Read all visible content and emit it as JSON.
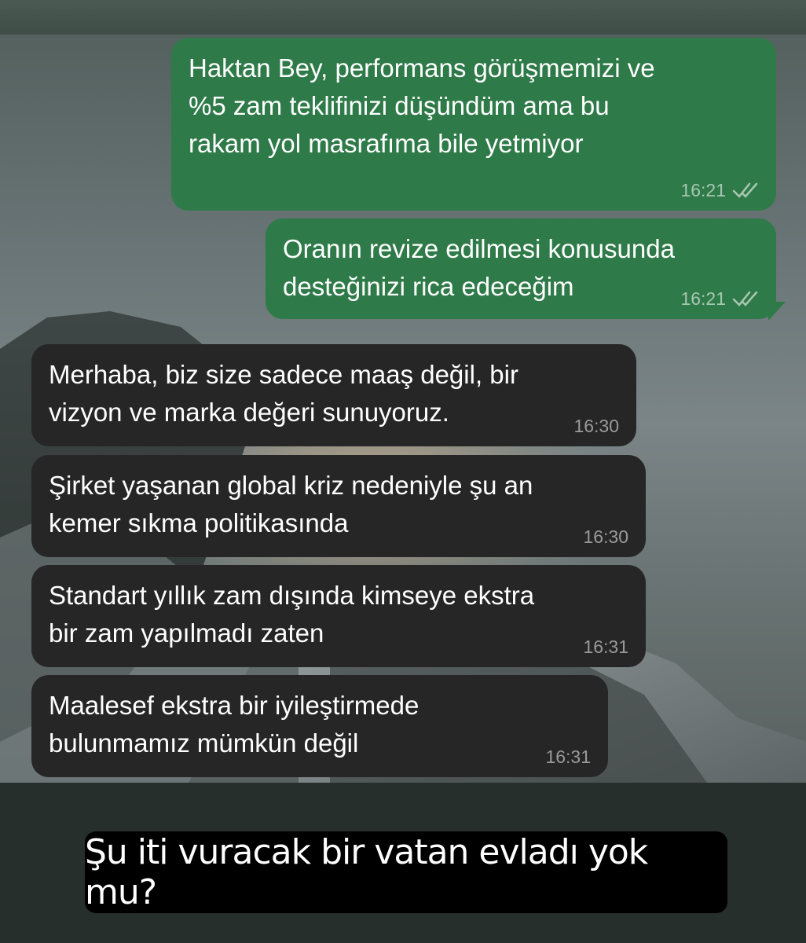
{
  "colors": {
    "outgoing_bubble": "#2e7a48",
    "incoming_bubble": "#262626",
    "caption_bg": "#000000"
  },
  "messages": [
    {
      "direction": "outgoing",
      "text": "Haktan Bey, performans görüşmemizi ve\n%5 zam teklifinizi düşündüm ama bu\nrakam yol masrafıma bile yetmiyor",
      "time": "16:21",
      "status_icon": "double-check-icon"
    },
    {
      "direction": "outgoing",
      "text": "Oranın revize edilmesi konusunda\ndesteğinizi rica edeceğim",
      "time": "16:21",
      "status_icon": "double-check-icon"
    },
    {
      "direction": "incoming",
      "text": "Merhaba, biz size sadece maaş değil, bir\nvizyon ve marka değeri sunuyoruz.",
      "time": "16:30"
    },
    {
      "direction": "incoming",
      "text": "Şirket yaşanan global kriz nedeniyle şu an\nkemer sıkma politikasında",
      "time": "16:30"
    },
    {
      "direction": "incoming",
      "text": "Standart yıllık zam dışında kimseye ekstra\nbir zam yapılmadı zaten",
      "time": "16:31"
    },
    {
      "direction": "incoming",
      "text": "Maalesef ekstra bir iyileştirmede\nbulunmamız mümkün değil",
      "time": "16:31"
    }
  ],
  "caption": {
    "text": "Şu iti vuracak bir vatan evladı yok mu?"
  }
}
